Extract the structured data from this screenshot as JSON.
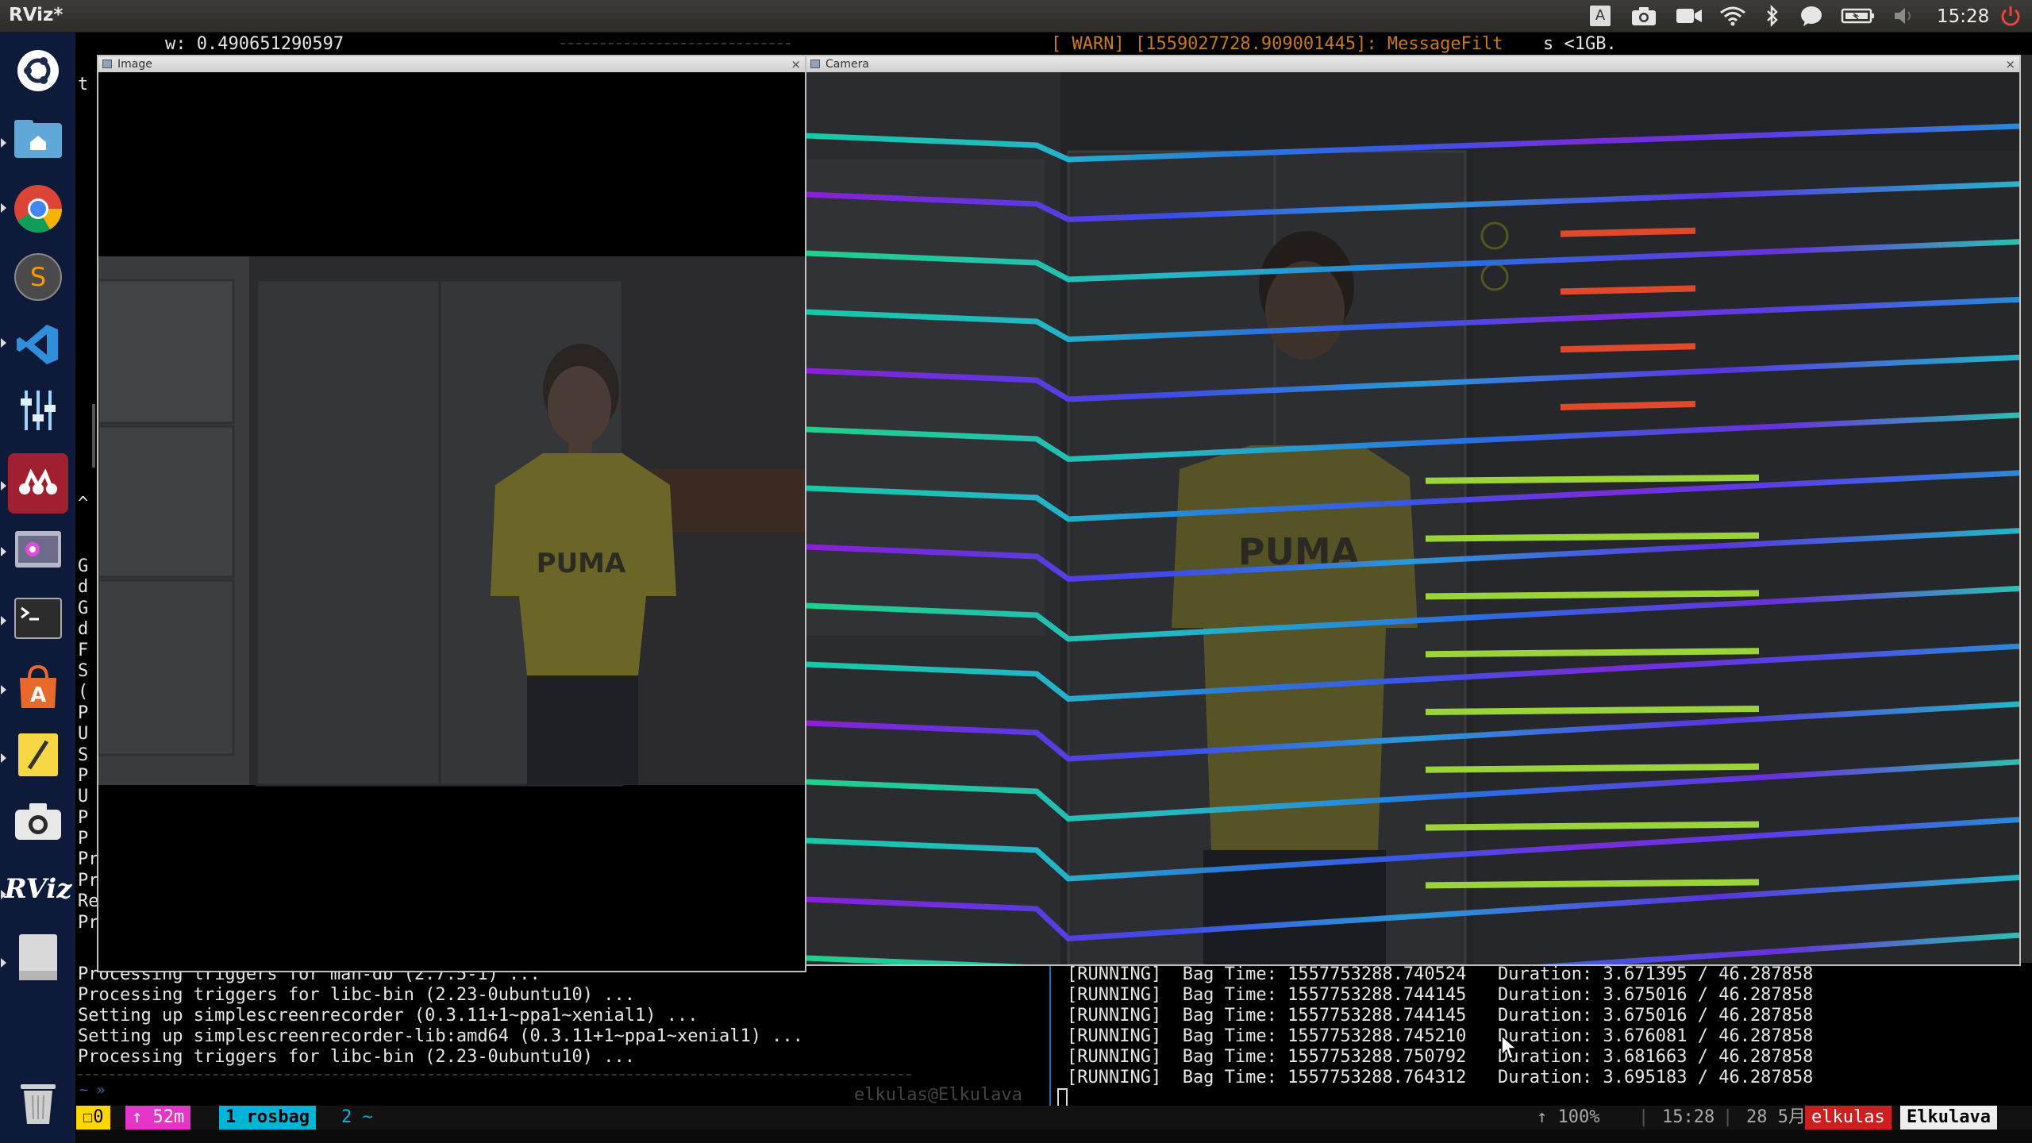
{
  "window": {
    "title": "RViz*"
  },
  "tray": {
    "keyboard_letter": "A",
    "clock": "15:28",
    "icons": [
      "keyboard-indicator-icon",
      "camera-icon",
      "video-camera-icon",
      "wifi-icon",
      "bluetooth-icon",
      "messages-icon",
      "battery-icon",
      "volume-icon",
      "power-icon"
    ]
  },
  "launcher": {
    "items": [
      {
        "name": "ubuntu-dash",
        "icon": "ubuntu-logo-icon"
      },
      {
        "name": "files",
        "icon": "home-folder-icon"
      },
      {
        "name": "chrome",
        "icon": "chrome-icon"
      },
      {
        "name": "sublime-text",
        "icon": "sublime-icon"
      },
      {
        "name": "vscode",
        "icon": "vscode-icon"
      },
      {
        "name": "settings-tuning",
        "icon": "sliders-icon"
      },
      {
        "name": "mendeley",
        "icon": "mendeley-icon"
      },
      {
        "name": "screen-recorder",
        "icon": "screen-recorder-icon"
      },
      {
        "name": "terminal",
        "icon": "terminal-icon"
      },
      {
        "name": "software-center",
        "icon": "software-center-icon"
      },
      {
        "name": "text-editor",
        "icon": "pencil-icon"
      },
      {
        "name": "screenshot",
        "icon": "camera-icon"
      },
      {
        "name": "rviz",
        "icon": "rviz-icon",
        "label": "RViz"
      },
      {
        "name": "drive",
        "icon": "drive-icon"
      },
      {
        "name": "trash",
        "icon": "trash-icon"
      }
    ]
  },
  "colors": {
    "launcher_bg": "#0e1a3a",
    "status_yellow": "#ffd700",
    "status_magenta": "#e535c8",
    "status_cyan": "#00b4d8",
    "status_red": "#cc1f1f",
    "warn_orange": "#c77a1f"
  },
  "overlay": {
    "w_value": "w: 0.490651290597",
    "warn_text": "[ WARN] [1559027728.909001445]: MessageFilt",
    "warn_suffix": "s <1GB."
  },
  "left_sliver_chars": [
    "t",
    "",
    "",
    "",
    "",
    "",
    "",
    "",
    "",
    "",
    "",
    "",
    "",
    "",
    "",
    "",
    "",
    "",
    "",
    "",
    "^",
    "",
    "",
    "G",
    "d",
    "G",
    "d",
    "F",
    "S",
    "(",
    "P",
    "U",
    "S",
    "P",
    "U",
    "P",
    "P",
    "Pr",
    "Pr",
    "Re",
    "Pr"
  ],
  "panels": {
    "image": {
      "title": "Image"
    },
    "camera": {
      "title": "Camera",
      "shirt_text": "PUMA"
    }
  },
  "image_panel": {
    "shirt_text": "PUMA"
  },
  "terminal_left": {
    "lines": [
      "Processing triggers for man-db (2.7.5-1) ...",
      "Processing triggers for libc-bin (2.23-0ubuntu10) ...",
      "Setting up simplescreenrecorder (0.3.11+1~ppa1~xenial1) ...",
      "Setting up simplescreenrecorder-lib:amd64 (0.3.11+1~ppa1~xenial1) ...",
      "Processing triggers for libc-bin (2.23-0ubuntu10) ..."
    ],
    "prompt": "~ »",
    "hostname": "elkulas@Elkulava"
  },
  "terminal_right": {
    "lines": [
      "[RUNNING]  Bag Time: 1557753288.740524   Duration: 3.671395 / 46.287858",
      "[RUNNING]  Bag Time: 1557753288.744145   Duration: 3.675016 / 46.287858",
      "[RUNNING]  Bag Time: 1557753288.744145   Duration: 3.675016 / 46.287858",
      "[RUNNING]  Bag Time: 1557753288.745210   Duration: 3.676081 / 46.287858",
      "[RUNNING]  Bag Time: 1557753288.750792   Duration: 3.681663 / 46.287858",
      "[RUNNING]  Bag Time: 1557753288.764312   Duration: 3.695183 / 46.287858"
    ]
  },
  "statusbar": {
    "session_count": "0",
    "uptime": "↑ 52m",
    "window1": "1 rosbag",
    "window2": "2 ~",
    "load": "↑ 100%",
    "time": "15:28",
    "date": "28 5月",
    "user": "elkulas",
    "host": "Elkulava"
  }
}
